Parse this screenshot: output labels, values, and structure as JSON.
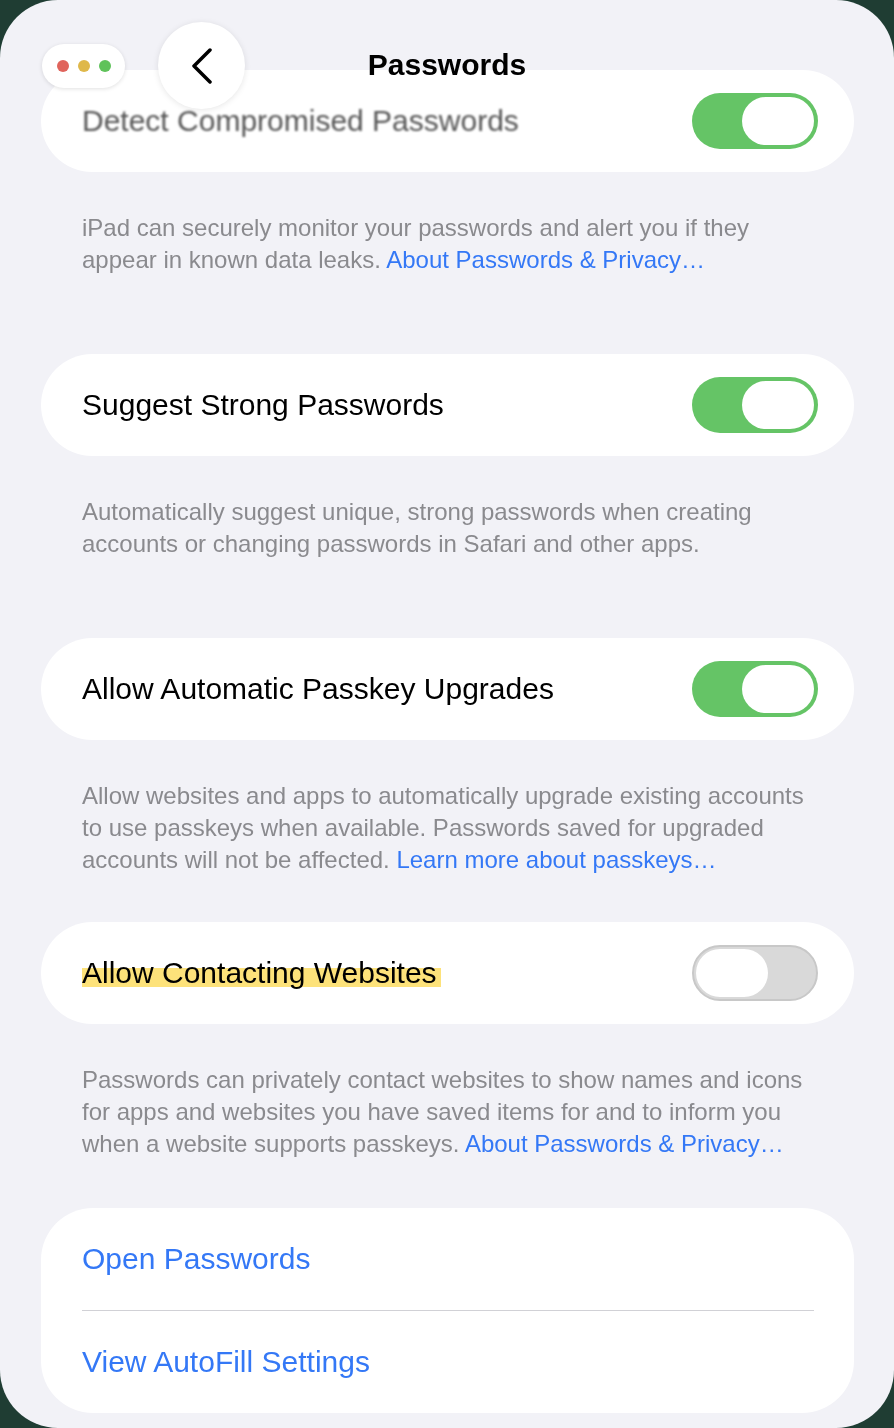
{
  "header": {
    "title": "Passwords"
  },
  "sections": [
    {
      "label": "Detect Compromised Passwords",
      "on": true,
      "highlighted": false,
      "dimmed": true,
      "footer": "iPad can securely monitor your passwords and alert you if they appear in known data leaks.",
      "footer_link": "About Passwords & Privacy…"
    },
    {
      "label": "Suggest Strong Passwords",
      "on": true,
      "highlighted": false,
      "dimmed": false,
      "footer": "Automatically suggest unique, strong passwords when creating accounts or changing passwords in Safari and other apps."
    },
    {
      "label": "Allow Automatic Passkey Upgrades",
      "on": true,
      "highlighted": false,
      "dimmed": false,
      "footer": "Allow websites and apps to automatically upgrade existing accounts to use passkeys when available. Passwords saved for upgraded accounts will not be affected.",
      "footer_link": "Learn more about passkeys…"
    },
    {
      "label": "Allow Contacting Websites",
      "on": false,
      "highlighted": true,
      "dimmed": false,
      "footer": "Passwords can privately contact websites to show names and icons for apps and websites you have saved items for and to inform you when a website supports passkeys.",
      "footer_link": "About Passwords & Privacy…"
    }
  ],
  "links": [
    "Open Passwords",
    "View AutoFill Settings"
  ]
}
